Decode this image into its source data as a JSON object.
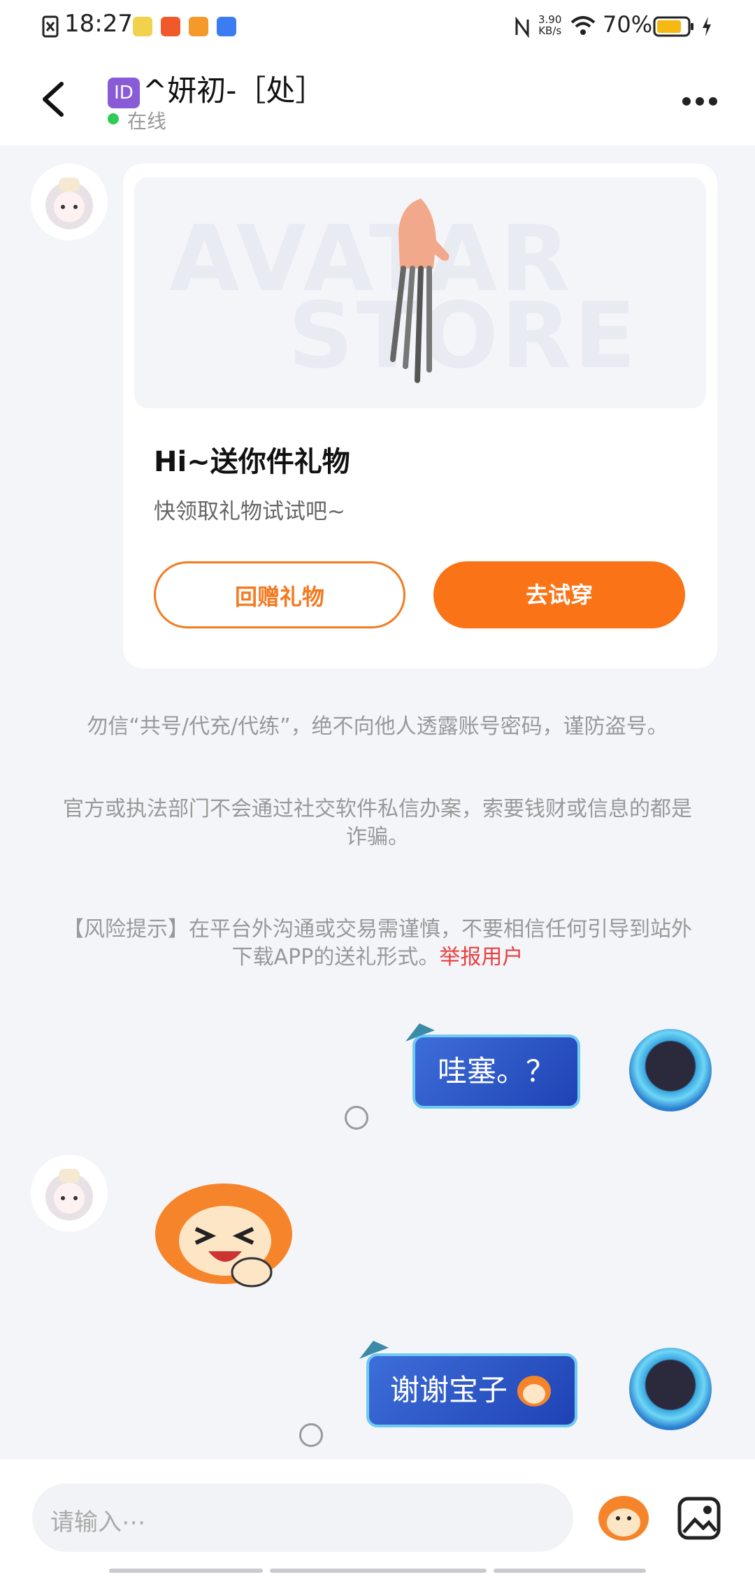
{
  "status_bar": {
    "time": "18:27",
    "net_speed_value": "3.90",
    "net_speed_unit": "KB/s",
    "battery_percent": "70%",
    "icons": [
      "sim-icon",
      "nfc-icon",
      "wifi-icon",
      "battery-icon",
      "charging-icon"
    ]
  },
  "header": {
    "back_icon": "chevron-left-icon",
    "id_badge": "ID",
    "title": "^妍初-［处］",
    "online_status": "在线",
    "more_icon": "more-icon"
  },
  "gift_card": {
    "watermark_top": "AVATAR",
    "watermark_bottom": "STORE",
    "title": "Hi~送你件礼物",
    "subtitle": "快领取礼物试试吧~",
    "return_gift_label": "回赠礼物",
    "try_on_label": "去试穿"
  },
  "notices": {
    "warn1": "勿信“共号/代充/代练”，绝不向他人透露账号密码，谨防盗号。",
    "warn2": "官方或执法部门不会通过社交软件私信办案，索要钱财或信息的都是诈骗。",
    "risk_prefix": "【风险提示】在平台外沟通或交易需谨慎，不要相信任何引导到站外下载APP的送礼形式。",
    "report_link": "举报用户"
  },
  "messages": [
    {
      "side": "right",
      "text": "哇塞。？"
    },
    {
      "side": "left",
      "type": "sticker"
    },
    {
      "side": "right",
      "text": "谢谢宝子"
    }
  ],
  "composer": {
    "placeholder": "请输入⋯",
    "emoji_icon": "sticker-icon",
    "image_icon": "image-icon"
  }
}
